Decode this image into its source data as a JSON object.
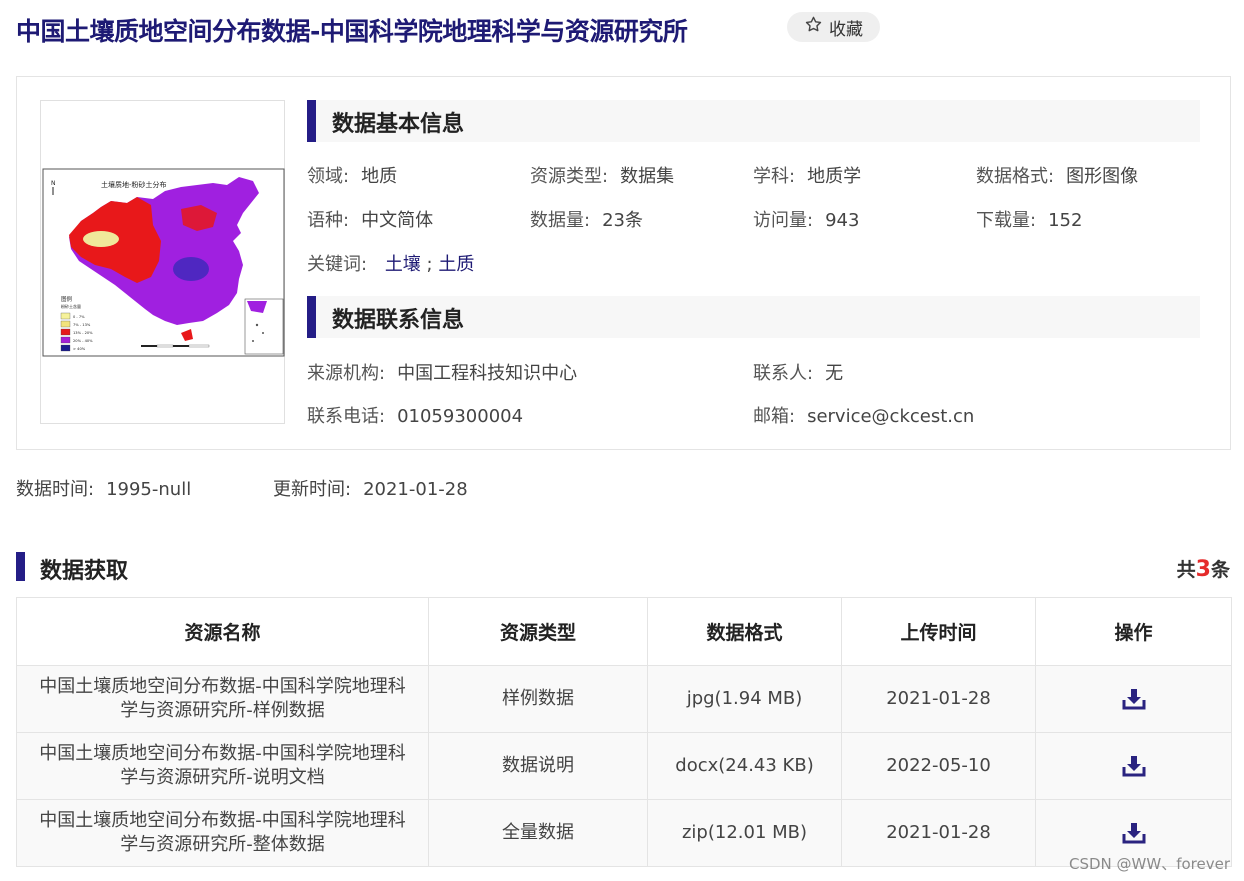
{
  "page": {
    "title": "中国土壤质地空间分布数据-中国科学院地理科学与资源研究所",
    "favorite_label": "收藏"
  },
  "thumbnail": {
    "map_title": "土壤质地-粉砂土分布",
    "legend_title": "图例",
    "legend_subtitle": "粉砂土含量",
    "legend_items": [
      "0 - 7%",
      "7% - 13%",
      "13% - 20%",
      "20% - 40%",
      "> 40%"
    ],
    "legend_colors": [
      "#f6f29a",
      "#f2e37c",
      "#e51b1b",
      "#a31fd6",
      "#1a1a8e"
    ],
    "map_colors": {
      "main": "#a020e0",
      "west": "#e8181a",
      "desert": "#f0e89a",
      "blue": "#2c2bb4"
    }
  },
  "basic_info": {
    "heading": "数据基本信息",
    "domain_label": "领域:",
    "domain_value": "地质",
    "type_label": "资源类型:",
    "type_value": "数据集",
    "subject_label": "学科:",
    "subject_value": "地质学",
    "format_label": "数据格式:",
    "format_value": "图形图像",
    "lang_label": "语种:",
    "lang_value": "中文简体",
    "count_label": "数据量:",
    "count_value": "23条",
    "visits_label": "访问量:",
    "visits_value": "943",
    "downloads_label": "下载量:",
    "downloads_value": "152",
    "keywords_label": "关键词:",
    "keyword_1": "土壤",
    "keyword_sep": ";",
    "keyword_2": "土质"
  },
  "contact_info": {
    "heading": "数据联系信息",
    "org_label": "来源机构:",
    "org_value": "中国工程科技知识中心",
    "person_label": "联系人:",
    "person_value": "无",
    "phone_label": "联系电话:",
    "phone_value": "01059300004",
    "email_label": "邮箱:",
    "email_value": "service@ckcest.cn"
  },
  "meta": {
    "data_time_label": "数据时间:",
    "data_time_value": "1995-null",
    "update_time_label": "更新时间:",
    "update_time_value": "2021-01-28"
  },
  "acquisition": {
    "heading": "数据获取",
    "count_prefix": "共",
    "count_value": "3",
    "count_suffix": "条",
    "columns": [
      "资源名称",
      "资源类型",
      "数据格式",
      "上传时间",
      "操作"
    ],
    "rows": [
      {
        "name_line1": "中国土壤质地空间分布数据-中国科学院地理科",
        "name_line2": "学与资源研究所-样例数据",
        "type": "样例数据",
        "format": "jpg(1.94 MB)",
        "date": "2021-01-28"
      },
      {
        "name_line1": "中国土壤质地空间分布数据-中国科学院地理科",
        "name_line2": "学与资源研究所-说明文档",
        "type": "数据说明",
        "format": "docx(24.43 KB)",
        "date": "2022-05-10"
      },
      {
        "name_line1": "中国土壤质地空间分布数据-中国科学院地理科",
        "name_line2": "学与资源研究所-整体数据",
        "type": "全量数据",
        "format": "zip(12.01 MB)",
        "date": "2021-01-28"
      }
    ],
    "action_icon": "download-icon"
  },
  "watermark": "CSDN @WW、forever"
}
